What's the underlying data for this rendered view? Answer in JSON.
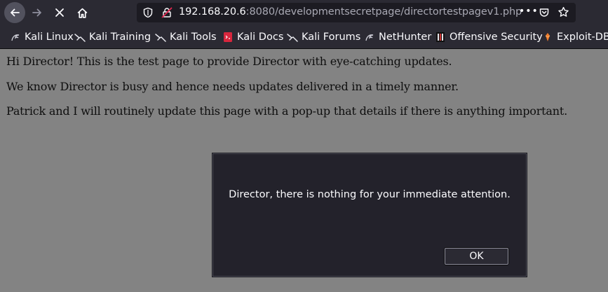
{
  "browser": {
    "url_host": "192.168.20.6",
    "url_rest": ":8080/developmentsecretpage/directortestpagev1.php",
    "more_label": "•••"
  },
  "bookmarks": [
    {
      "label": "Kali Linux",
      "icon": "kali-dragon-icon"
    },
    {
      "label": "Kali Training",
      "icon": "kali-dragon-icon"
    },
    {
      "label": "Kali Tools",
      "icon": "kali-dragon-icon"
    },
    {
      "label": "Kali Docs",
      "icon": "kali-docs-icon"
    },
    {
      "label": "Kali Forums",
      "icon": "kali-dragon-icon"
    },
    {
      "label": "NetHunter",
      "icon": "kali-dragon-icon"
    },
    {
      "label": "Offensive Security",
      "icon": "offsec-icon"
    },
    {
      "label": "Exploit-DB",
      "icon": "exploit-db-icon"
    }
  ],
  "page": {
    "line1": "Hi Director! This is the test page to provide Director with eye-catching updates.",
    "line2": "We know Director is busy and hence needs updates delivered in a timely manner.",
    "line3": "Patrick and I will routinely update this page with a pop-up that details if there is anything important."
  },
  "dialog": {
    "message": "Director, there is nothing for your immediate attention.",
    "ok_label": "OK"
  },
  "colors": {
    "toolbar": "#2b2a33",
    "urlbar": "#1c1b22",
    "page_bg": "#838383",
    "dialog_bg": "#23222b"
  }
}
